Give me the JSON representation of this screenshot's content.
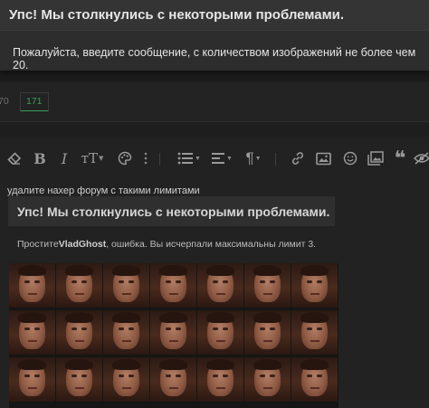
{
  "error_dialog": {
    "title": "Упс! Мы столкнулись с некоторыми проблемами.",
    "message": "Пожалуйста, введите сообщение, с количеством изображений не более чем 20."
  },
  "pagination": {
    "partial_page": "70",
    "current_page": "171"
  },
  "toolbar": {
    "icons": [
      "eraser-icon",
      "bold-icon",
      "italic-icon",
      "text-size-icon",
      "palette-icon",
      "list-icon",
      "align-icon",
      "paragraph-icon",
      "link-icon",
      "image-icon",
      "emoji-icon",
      "media-gallery-icon",
      "quote-icon",
      "spoiler-icon"
    ]
  },
  "post": {
    "text": "удалите нахер форум с такими лимитами",
    "quote_title": "Упс! Мы столкнулись с некоторыми проблемами.",
    "limit_prefix": "Простите",
    "limit_user": "VladGhost",
    "limit_suffix": ", ошибка. Вы исчерпали максимальны лимит 3."
  },
  "image_grid": {
    "columns": 7,
    "rows_visible": 3
  }
}
